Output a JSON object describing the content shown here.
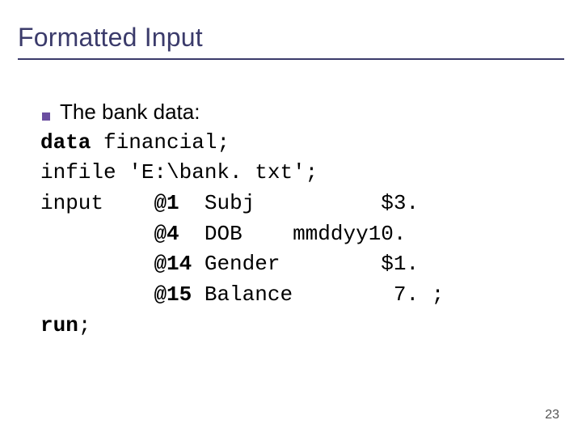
{
  "title": "Formatted Input",
  "bullet_text": "The bank data:",
  "code": {
    "kw_data": "data",
    "l1_rest": " financial;",
    "l2": "infile 'E:\\bank. txt';",
    "l3_prefix": "input    ",
    "l3_at": "@1",
    "l3_rest": "  Subj          $3.",
    "indent": "         ",
    "l4_at": "@4",
    "l4_rest": "  DOB    mmddyy10.",
    "l5_at": "@14",
    "l5_rest": " Gender        $1.",
    "l6_at": "@15",
    "l6_rest": " Balance        7. ;",
    "kw_run": "run",
    "run_semi": ";"
  },
  "page_number": "23"
}
